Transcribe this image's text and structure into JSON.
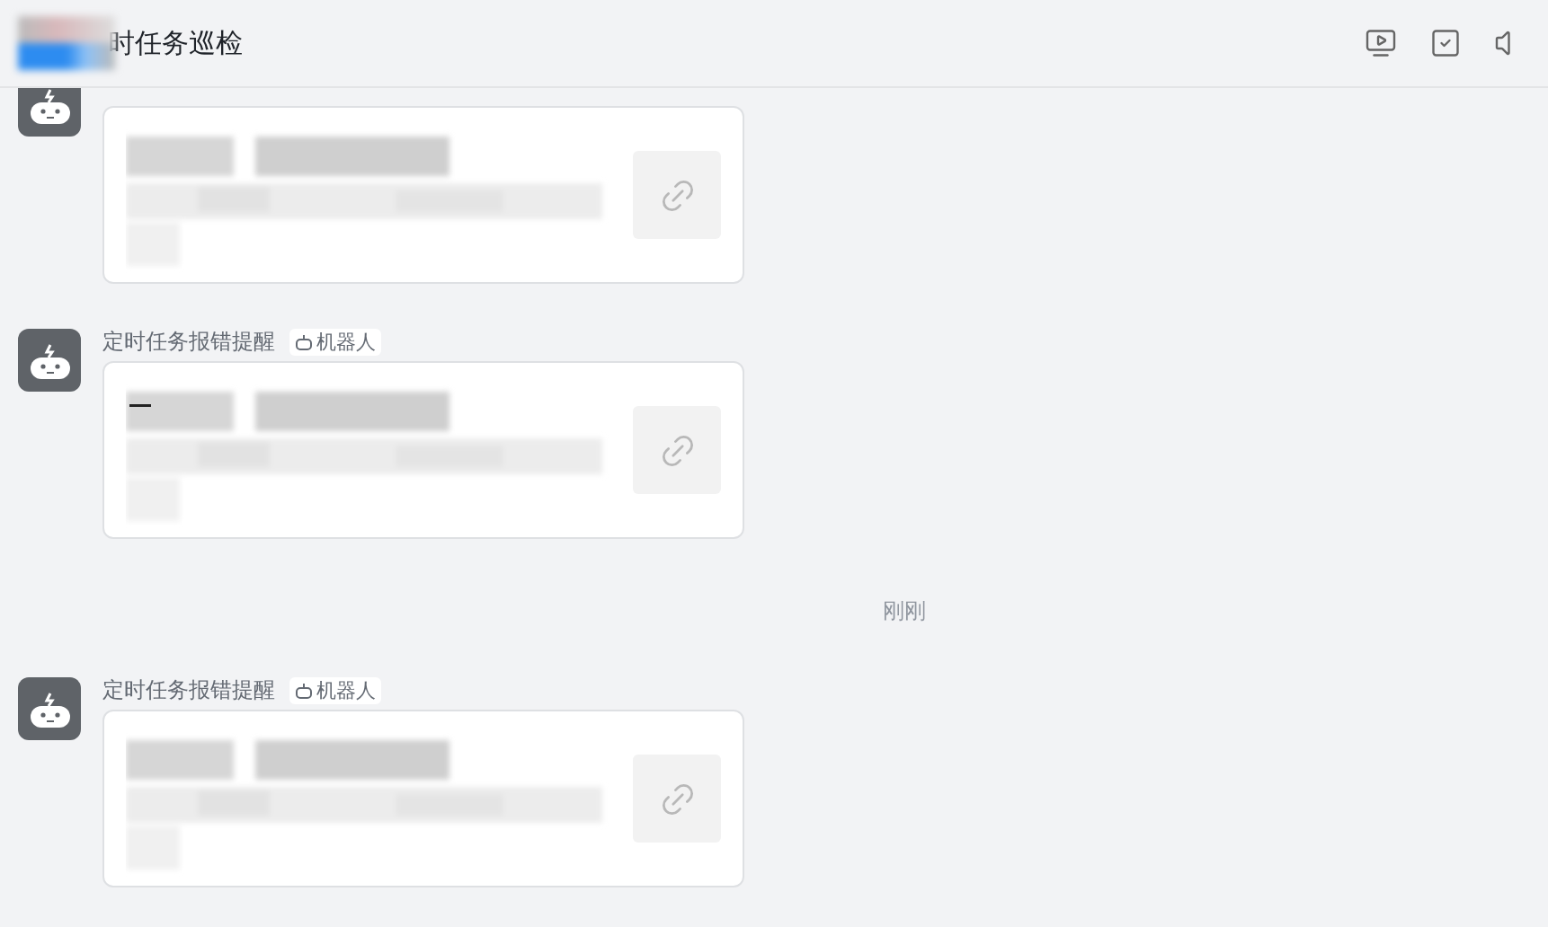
{
  "header": {
    "title": "时任务巡检"
  },
  "timeline": [
    {
      "kind": "message",
      "dash": false
    },
    {
      "kind": "message",
      "sender": "定时任务报错提醒",
      "tag": "机器人",
      "dash": true
    },
    {
      "kind": "time",
      "text": "刚刚"
    },
    {
      "kind": "message",
      "sender": "定时任务报错提醒",
      "tag": "机器人",
      "dash": false
    }
  ]
}
